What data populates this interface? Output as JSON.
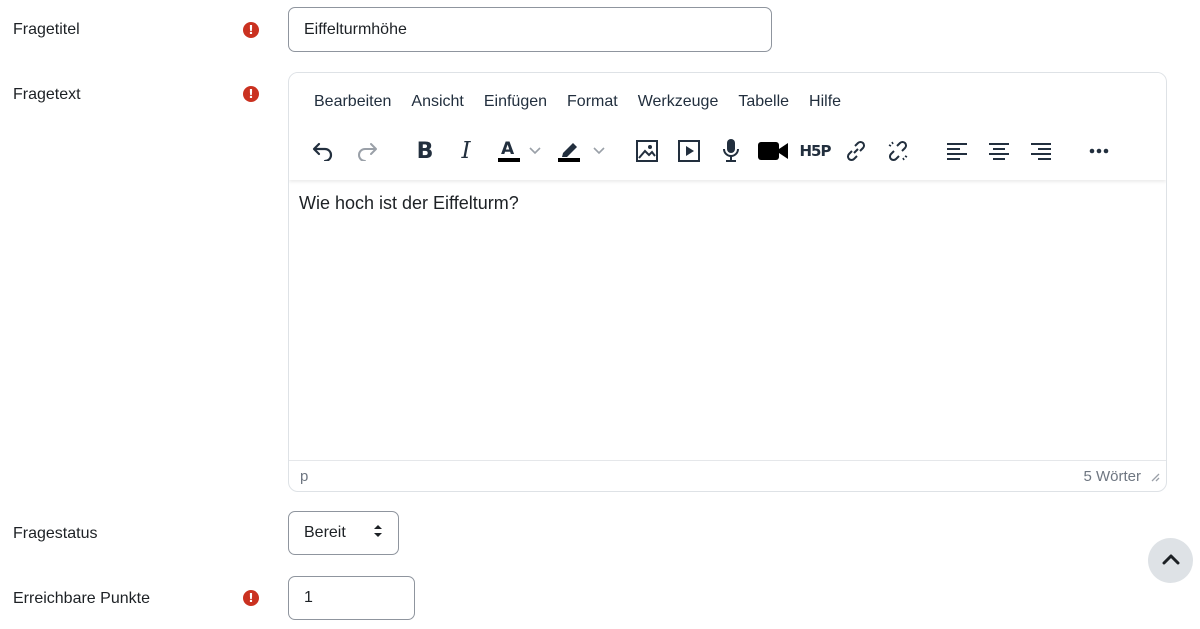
{
  "form": {
    "question_title": {
      "label": "Fragetitel",
      "value": "Eiffelturmhöhe",
      "required_icon": "exclamation-circle-icon"
    },
    "question_text": {
      "label": "Fragetext",
      "required_icon": "exclamation-circle-icon",
      "menu": [
        "Bearbeiten",
        "Ansicht",
        "Einfügen",
        "Format",
        "Werkzeuge",
        "Tabelle",
        "Hilfe"
      ],
      "content": "Wie hoch ist der Eiffelturm?",
      "status_path": "p",
      "word_count": "5 Wörter"
    },
    "question_status": {
      "label": "Fragestatus",
      "selected": "Bereit"
    },
    "points": {
      "label": "Erreichbare Punkte",
      "value": "1",
      "required_icon": "exclamation-circle-icon"
    }
  },
  "colors": {
    "required": "#ca3120",
    "border": "#8f959e",
    "text": "#1d2125"
  }
}
